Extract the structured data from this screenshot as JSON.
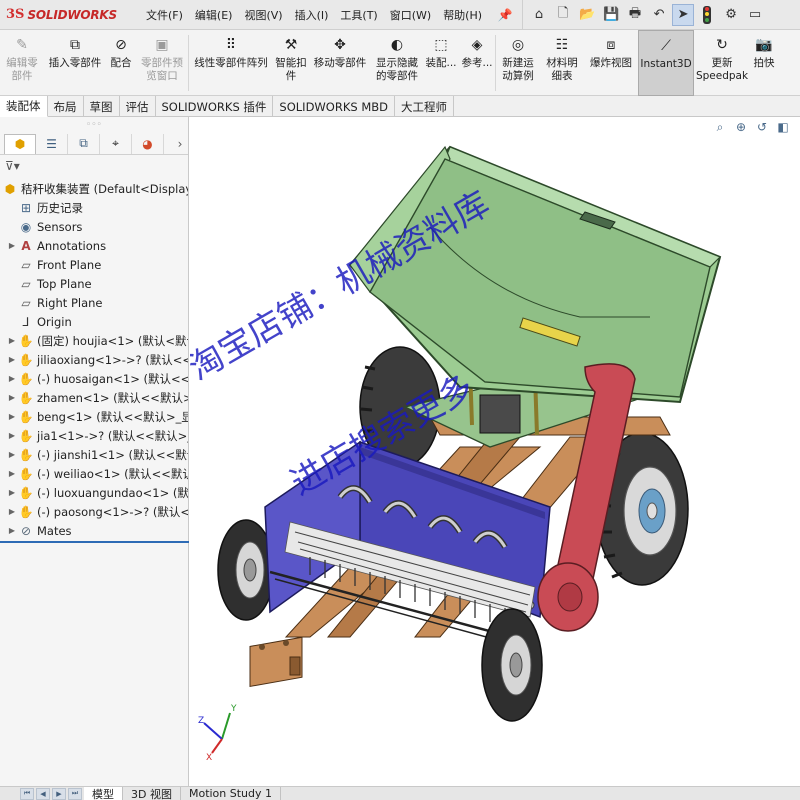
{
  "app": {
    "logo_ds": "3S",
    "logo_text": "SOLIDWORKS"
  },
  "menu": [
    "文件(F)",
    "编辑(E)",
    "视图(V)",
    "插入(I)",
    "工具(T)",
    "窗口(W)",
    "帮助(H)"
  ],
  "quick_access": [
    {
      "name": "home-icon",
      "glyph": "⌂"
    },
    {
      "name": "new-file-icon",
      "glyph": "🗋"
    },
    {
      "name": "open-file-icon",
      "glyph": "📂"
    },
    {
      "name": "save-icon",
      "glyph": "💾"
    },
    {
      "name": "print-icon",
      "glyph": "🖶"
    },
    {
      "name": "undo-icon",
      "glyph": "↶"
    },
    {
      "name": "select-arrow-icon",
      "glyph": "➤"
    },
    {
      "name": "options-gear-icon",
      "glyph": "⚙"
    },
    {
      "name": "rebuild-icon",
      "glyph": "▭"
    }
  ],
  "ribbon": [
    {
      "id": "edit-component",
      "line1": "编辑零",
      "line2": "部件",
      "icon": "✎",
      "disabled": true
    },
    {
      "id": "insert-component",
      "line1": "插入零部件",
      "line2": "",
      "icon": "⧉",
      "disabled": false
    },
    {
      "id": "mate",
      "line1": "配合",
      "line2": "",
      "icon": "⊘",
      "disabled": false
    },
    {
      "id": "component-preview",
      "line1": "零部件预",
      "line2": "览窗口",
      "icon": "▣",
      "disabled": true
    },
    {
      "id": "linear-pattern",
      "line1": "线性零部件阵列",
      "line2": "",
      "icon": "⠿",
      "disabled": false
    },
    {
      "id": "smart-fasteners",
      "line1": "智能扣",
      "line2": "件",
      "icon": "⚒",
      "disabled": false
    },
    {
      "id": "move-component",
      "line1": "移动零部件",
      "line2": "",
      "icon": "✥",
      "disabled": false
    },
    {
      "id": "show-hidden",
      "line1": "显示隐藏",
      "line2": "的零部件",
      "icon": "◐",
      "disabled": false
    },
    {
      "id": "assembly-features",
      "line1": "装配...",
      "line2": "",
      "icon": "⬚",
      "disabled": false
    },
    {
      "id": "reference-geometry",
      "line1": "参考...",
      "line2": "",
      "icon": "◈",
      "disabled": false
    },
    {
      "id": "new-motion-study",
      "line1": "新建运",
      "line2": "动算例",
      "icon": "◎",
      "disabled": false
    },
    {
      "id": "bill-of-materials",
      "line1": "材料明",
      "line2": "细表",
      "icon": "☷",
      "disabled": false
    },
    {
      "id": "exploded-view",
      "line1": "爆炸视图",
      "line2": "",
      "icon": "⧈",
      "disabled": false
    },
    {
      "id": "instant3d",
      "line1": "Instant3D",
      "line2": "",
      "icon": "⟋",
      "disabled": false
    },
    {
      "id": "update-speedpak",
      "line1": "更新",
      "line2": "Speedpak",
      "icon": "↻",
      "disabled": false
    },
    {
      "id": "snapshot",
      "line1": "拍快",
      "line2": "",
      "icon": "📷",
      "disabled": false
    }
  ],
  "command_tabs": [
    "装配体",
    "布局",
    "草图",
    "评估",
    "SOLIDWORKS 插件",
    "SOLIDWORKS MBD",
    "大工程师"
  ],
  "panel_tabs": [
    {
      "name": "feature-manager-tab-icon",
      "glyph": "⬢"
    },
    {
      "name": "property-manager-tab-icon",
      "glyph": "☰"
    },
    {
      "name": "configuration-manager-tab-icon",
      "glyph": "⧉"
    },
    {
      "name": "dimxpert-tab-icon",
      "glyph": "⌖"
    },
    {
      "name": "display-manager-tab-icon",
      "glyph": "◕"
    }
  ],
  "tree": {
    "root": "秸秆收集装置 (Default<Display State-1>)",
    "fixed": [
      {
        "label": "历史记录",
        "icon": "history-icon",
        "glyph": "⊞"
      },
      {
        "label": "Sensors",
        "icon": "sensors-icon",
        "glyph": "◉"
      },
      {
        "label": "Annotations",
        "icon": "annotations-icon",
        "glyph": "A"
      },
      {
        "label": "Front Plane",
        "icon": "plane-icon",
        "glyph": "▱"
      },
      {
        "label": "Top Plane",
        "icon": "plane-icon",
        "glyph": "▱"
      },
      {
        "label": "Right Plane",
        "icon": "plane-icon",
        "glyph": "▱"
      },
      {
        "label": "Origin",
        "icon": "origin-icon",
        "glyph": "⅃"
      }
    ],
    "components": [
      "(固定) houjia<1> (默认<默认",
      "jiliaoxiang<1>->? (默认<<默认",
      "(-) huosaigan<1> (默认<<默认",
      "zhamen<1> (默认<<默认>_显",
      "beng<1> (默认<<默认>_显示",
      "jia1<1>->? (默认<<默认>_显",
      "(-) jianshi1<1> (默认<<默认",
      "(-) weiliao<1> (默认<<默认>",
      "(-) luoxuangundao<1> (默认",
      "(-) paosong<1>->? (默认<<默认"
    ],
    "mates": "Mates"
  },
  "watermark": {
    "line1": "淘宝店铺：机械资料库",
    "line2": "进店搜索更多"
  },
  "bottom_tabs": [
    "模型",
    "3D 视图",
    "Motion Study 1"
  ],
  "colors": {
    "hopper": "#8fbf86",
    "hopper_edge": "#2d4a2a",
    "frame": "#c98e5a",
    "blue_housing": "#4a46b8",
    "red_arm": "#c94b55",
    "tire": "#3b3b3b",
    "rim": "#d8d8d8",
    "platform": "#97c48d",
    "watermark": "#1a1abf"
  }
}
